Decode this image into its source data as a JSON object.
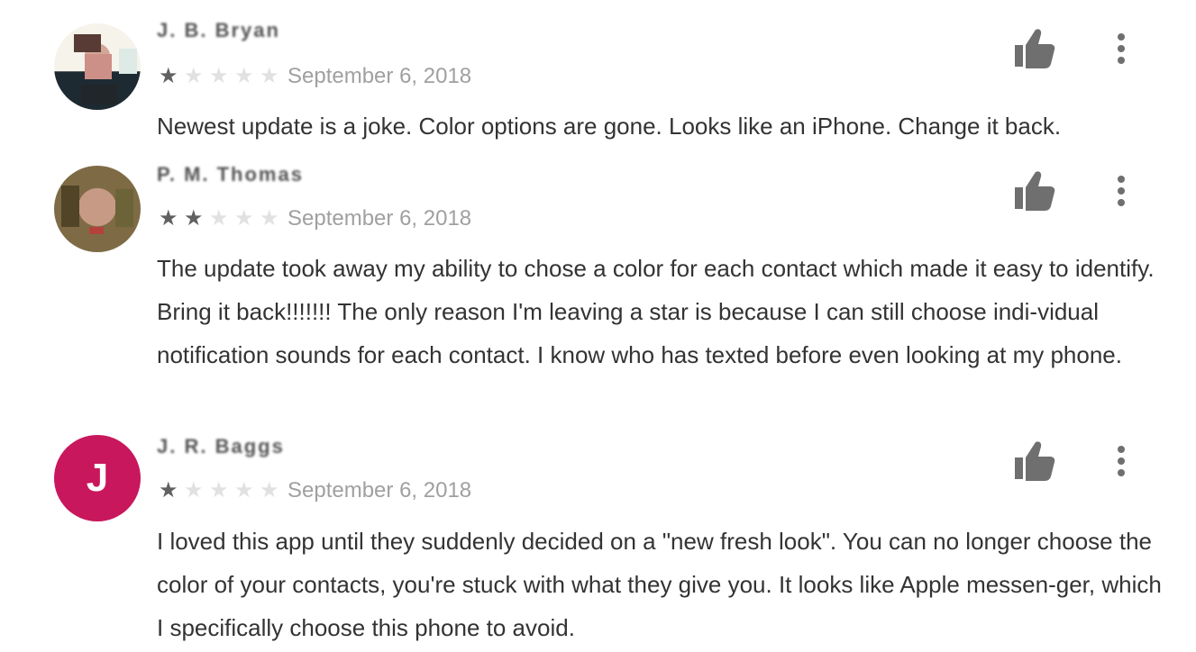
{
  "reviews": [
    {
      "name": "J. B. Bryan",
      "avatar": {
        "type": "photo",
        "letter": ""
      },
      "stars": 1,
      "max_stars": 5,
      "date": "September 6, 2018",
      "text": "Newest update is a joke. Color options are gone. Looks like an iPhone. Change it back."
    },
    {
      "name": "P. M. Thomas",
      "avatar": {
        "type": "photo",
        "letter": ""
      },
      "stars": 2,
      "max_stars": 5,
      "date": "September 6, 2018",
      "text": "The update took away my ability to chose a color for each contact which made it easy to identify. Bring it back!!!!!!! The only reason I'm leaving a star is because I can still choose indi-vidual notification sounds for each contact. I know who has texted before even looking at my phone."
    },
    {
      "name": "J. R. Baggs",
      "avatar": {
        "type": "letter",
        "letter": "J"
      },
      "stars": 1,
      "max_stars": 5,
      "date": "September 6, 2018",
      "text": "I loved this app until they suddenly decided on a \"new fresh look\". You can no longer choose the color of your contacts, you're stuck with what they give you. It looks like Apple messen-ger, which I specifically choose this phone to avoid."
    }
  ],
  "icons": {
    "thumb": "thumb-up-icon",
    "more": "more-vert-icon",
    "filled_star": "star-filled",
    "empty_star": "star-empty"
  },
  "colors": {
    "thumb": "#6f6f6f",
    "more": "#6f6f6f",
    "star_filled": "#616161",
    "star_empty": "#e1e1e1",
    "date": "#a0a0a0",
    "text": "#333333",
    "mono_avatar": "#c8175d"
  }
}
